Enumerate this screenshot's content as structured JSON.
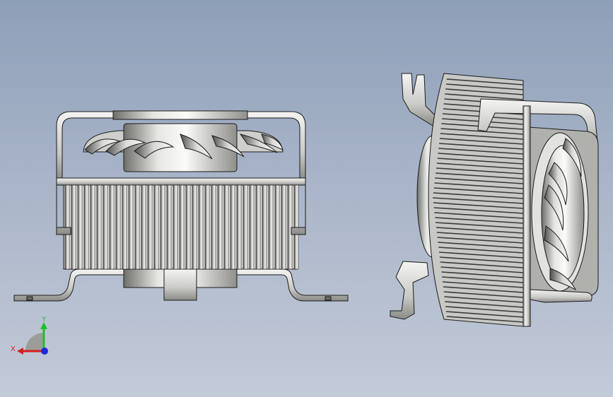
{
  "viewport": {
    "background_top": "#8e9fb8",
    "background_bottom": "#c3cad8"
  },
  "triad": {
    "x_label": "X",
    "y_label": "Y",
    "x_color": "#d81e1e",
    "y_color": "#1fbf2a",
    "z_color": "#1a2ad8"
  },
  "model": {
    "metal_light": "#e8e8e6",
    "metal_mid": "#b5b5b2",
    "metal_dark": "#5a5a58",
    "edge": "#1a1a1a",
    "views": [
      "front-view",
      "isometric-view"
    ]
  }
}
